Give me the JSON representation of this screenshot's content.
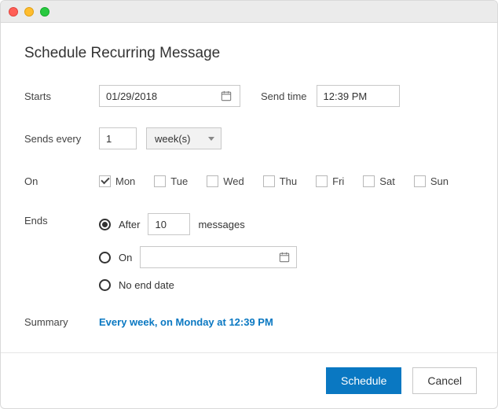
{
  "title": "Schedule Recurring Message",
  "labels": {
    "starts": "Starts",
    "send_time": "Send time",
    "sends_every": "Sends every",
    "on": "On",
    "ends": "Ends",
    "summary": "Summary"
  },
  "starts_value": "01/29/2018",
  "send_time_value": "12:39 PM",
  "interval_value": "1",
  "interval_unit": "week(s)",
  "days": [
    {
      "label": "Mon",
      "checked": true
    },
    {
      "label": "Tue",
      "checked": false
    },
    {
      "label": "Wed",
      "checked": false
    },
    {
      "label": "Thu",
      "checked": false
    },
    {
      "label": "Fri",
      "checked": false
    },
    {
      "label": "Sat",
      "checked": false
    },
    {
      "label": "Sun",
      "checked": false
    }
  ],
  "ends": {
    "selected": "after",
    "after_prefix": "After",
    "after_count": "10",
    "after_suffix": "messages",
    "on_label": "On",
    "on_date": "",
    "no_end_label": "No end date"
  },
  "summary_text": "Every week, on Monday at 12:39 PM",
  "buttons": {
    "schedule": "Schedule",
    "cancel": "Cancel"
  }
}
